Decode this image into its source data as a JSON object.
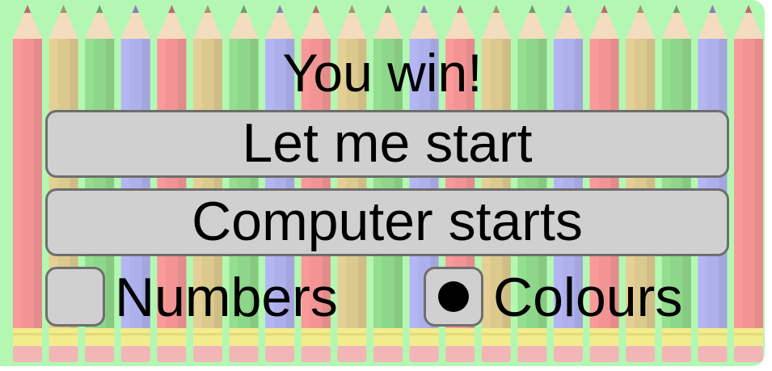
{
  "game": {
    "status": "You win!",
    "buttons": {
      "player_start": "Let me start",
      "computer_start": "Computer starts"
    },
    "mode_options": [
      {
        "label": "Numbers",
        "selected": false
      },
      {
        "label": "Colours",
        "selected": true
      }
    ]
  },
  "background": {
    "color": "#b3f7b3",
    "pencil_colors": [
      "#f29494",
      "#dcc98e",
      "#8ed68a",
      "#aeb0ec"
    ]
  }
}
